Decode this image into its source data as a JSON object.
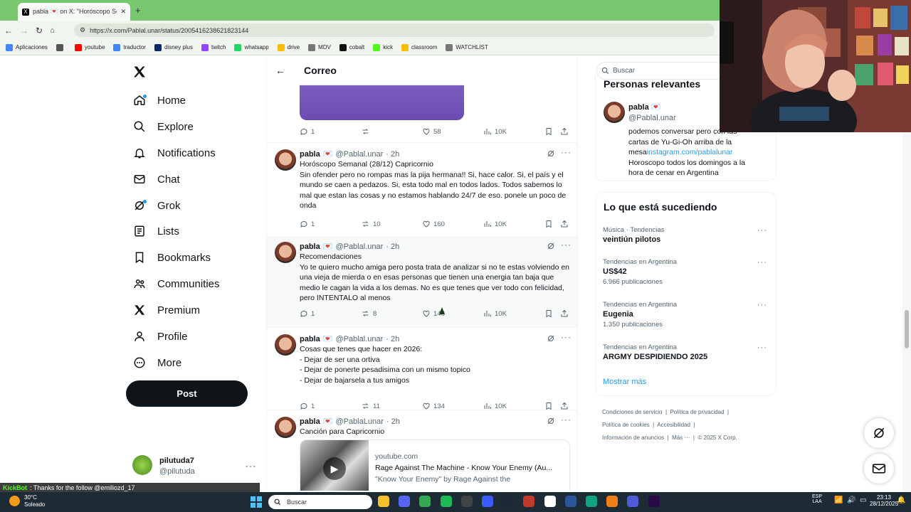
{
  "browser": {
    "tab_title": "pabla 💌 on X: \"Horóscopo Se",
    "url": "https://x.com/Pablal.unar/status/2005416238621823144",
    "bookmarks": [
      {
        "label": "Aplicaciones",
        "color": "#4285f4"
      },
      {
        "label": "",
        "color": "#555"
      },
      {
        "label": "youtube",
        "color": "#ff0000"
      },
      {
        "label": "traductor",
        "color": "#4285f4"
      },
      {
        "label": "disney plus",
        "color": "#0a2a66"
      },
      {
        "label": "twitch",
        "color": "#9146ff"
      },
      {
        "label": "whatsapp",
        "color": "#25d366"
      },
      {
        "label": "drive",
        "color": "#fbbc04"
      },
      {
        "label": "MDV",
        "color": "#777"
      },
      {
        "label": "cobalt",
        "color": "#111"
      },
      {
        "label": "kick",
        "color": "#53fc18"
      },
      {
        "label": "classroom",
        "color": "#fbbc04"
      },
      {
        "label": "WATCHLIST",
        "color": "#777"
      }
    ]
  },
  "nav": {
    "items": [
      {
        "label": "Home",
        "icon": "home-icon"
      },
      {
        "label": "Explore",
        "icon": "search-icon"
      },
      {
        "label": "Notifications",
        "icon": "bell-icon"
      },
      {
        "label": "Chat",
        "icon": "mail-icon"
      },
      {
        "label": "Grok",
        "icon": "grok-icon"
      },
      {
        "label": "Lists",
        "icon": "list-icon"
      },
      {
        "label": "Bookmarks",
        "icon": "bookmark-icon"
      },
      {
        "label": "Communities",
        "icon": "people-icon"
      },
      {
        "label": "Premium",
        "icon": "x-logo-icon"
      },
      {
        "label": "Profile",
        "icon": "person-icon"
      },
      {
        "label": "More",
        "icon": "more-circle-icon"
      }
    ],
    "post_label": "Post",
    "account": {
      "name": "pilutuda7",
      "handle": "@pilutuda"
    }
  },
  "header": {
    "title": "Correo"
  },
  "tweets": [
    {
      "name": "pabla",
      "handle": "@Pablal.unar",
      "time": "· 2h",
      "text": "Horóscopo Semanal (28/12) Capricornio\nSin ofender pero no rompas mas la pija hermana!! Si, hace calor. Si, el país y el mundo se caen a pedazos. Si, esta todo mal en todos lados. Todos sabemos lo mal que estan las cosas y no estamos hablando 24/7 de eso. ponele un poco de onda",
      "replies": "1",
      "reposts": "10",
      "likes": "160",
      "views": "10K"
    },
    {
      "name": "pabla",
      "handle": "@Pablal.unar",
      "time": "· 2h",
      "text": "Recomendaciones\nYo te quiero mucho amiga pero posta trata de analizar si no te estas volviendo en una vieja de mierda o en esas personas que tienen una energia tan baja que medio le cagan la vida a los demas. No es que tenes que ver todo con felicidad, pero INTENTALO al menos",
      "replies": "1",
      "reposts": "8",
      "likes": "148",
      "views": "10K"
    },
    {
      "name": "pabla",
      "handle": "@Pablal.unar",
      "time": "· 2h",
      "text": "Cosas que tenes que hacer en 2026:\n- Dejar de ser una ortiva\n- Dejar de ponerte pesadisima con un mismo topico\n- Dejar de bajarsela a tus amigos",
      "replies": "1",
      "reposts": "11",
      "likes": "134",
      "views": "10K"
    },
    {
      "name": "pabla",
      "handle": "@PablaLunar",
      "time": "· 2h",
      "text": "Canción para Capricornio",
      "card": {
        "domain": "youtube.com",
        "title": "Rage Against The Machine - Know Your Enemy (Au...",
        "desc": "\"Know Your Enemy\" by Rage Against the"
      }
    }
  ],
  "top_tweet_actions": {
    "replies": "1",
    "reposts": "",
    "likes": "58",
    "views": "10K"
  },
  "right": {
    "search_placeholder": "Buscar",
    "relevant_title": "Personas relevantes",
    "person": {
      "name": "pabla",
      "handle": "@Pablal.unar",
      "bio": "podemos conversar pero con las cartas de Yu-Gi-Oh arriba de la mesa",
      "link": "instagram.com/pablalunar",
      "bio2": "Horoscopo todos los domingos a la hora de cenar en Argentina"
    },
    "trends_title": "Lo que está sucediendo",
    "trends": [
      {
        "category": "Música · Tendencias",
        "name": "veintiún pilotos",
        "count": ""
      },
      {
        "category": "Tendencias en Argentina",
        "name": "US$42",
        "count": "6.966 publicaciones"
      },
      {
        "category": "Tendencias en Argentina",
        "name": "Eugenia",
        "count": "1.350 publicaciones"
      },
      {
        "category": "Tendencias en Argentina",
        "name": "ARGMY DESPIDIENDO 2025",
        "count": ""
      }
    ],
    "show_more": "Mostrar más",
    "footer": {
      "l1a": "Condiciones de servicio",
      "l1b": "Política de privacidad",
      "l2a": "Política de cookies",
      "l2b": "Accesibilidad",
      "l3a": "Información de anuncios",
      "l3b": "Más ···",
      "l3c": "© 2025 X Corp."
    }
  },
  "stream": {
    "chat_user": "KickBot",
    "chat_msg": ": Thanks for the follow @emiliozd_17"
  },
  "taskbar": {
    "temp": "30°C",
    "weather": "Soleado",
    "search": "Buscar",
    "lang1": "ESP",
    "lang2": "LAA",
    "time": "23:13",
    "date": "28/12/2025"
  },
  "colors": {
    "accent": "#1d9bf0",
    "tabstrip": "#78c66e",
    "taskbar": "#1d2b36"
  }
}
